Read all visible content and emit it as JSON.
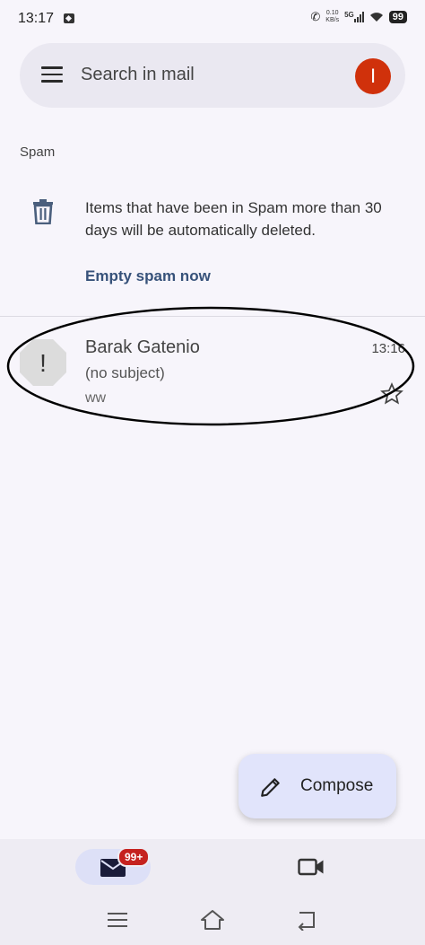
{
  "status_bar": {
    "time": "13:17",
    "speed_value": "0.10",
    "speed_unit": "KB/s",
    "network": "5G",
    "battery": "99"
  },
  "search": {
    "placeholder": "Search in mail",
    "avatar_letter": "I",
    "avatar_color": "#d0310b"
  },
  "folder": {
    "label": "Spam",
    "notice": "Items that have been in Spam more than 30 days will be automatically deleted.",
    "empty_action": "Empty spam now"
  },
  "emails": [
    {
      "sender": "Barak Gatenio",
      "subject": "(no subject)",
      "snippet": "ww",
      "time": "13:16",
      "starred": false,
      "avatar_glyph": "!"
    }
  ],
  "compose": {
    "label": "Compose"
  },
  "bottom_nav": {
    "mail_badge": "99+"
  },
  "icons": {
    "menu": "menu-icon",
    "trash": "trash-icon",
    "star": "star-outline-icon",
    "pencil": "pencil-icon",
    "mail": "mail-icon",
    "meet": "video-camera-icon"
  },
  "colors": {
    "accent_link": "#37527a",
    "compose_bg": "#e1e4fb",
    "badge": "#c5221f"
  }
}
